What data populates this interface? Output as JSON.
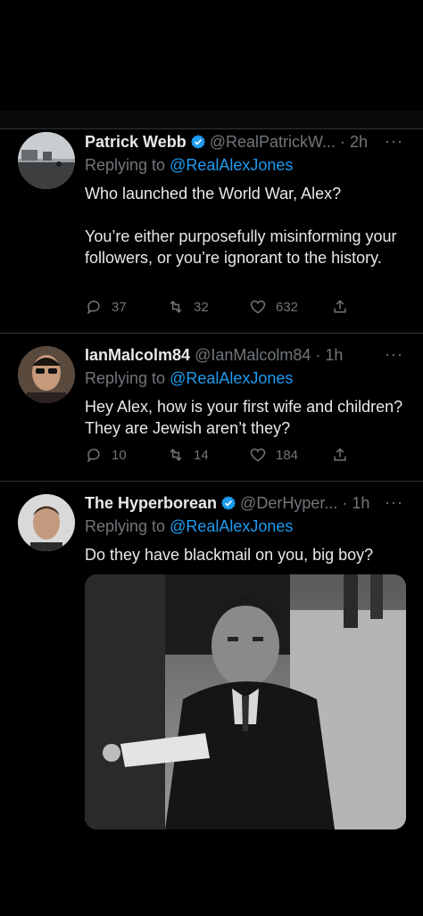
{
  "colors": {
    "background": "#000000",
    "text": "#e7e9ea",
    "muted": "#71767b",
    "link": "#1d9bf0",
    "verified": "#1d9bf0"
  },
  "replying_prefix": "Replying to",
  "tweets": [
    {
      "name": "Patrick Webb",
      "verified": true,
      "handle": "@RealPatrickW...",
      "time": "· 2h",
      "reply_to": "@RealAlexJones",
      "text": "Who launched the World War, Alex?\n\nYou’re either purposefully misinforming your followers, or you’re ignorant to the history.",
      "replies": "37",
      "retweets": "32",
      "likes": "632",
      "avatar_icon": "avatar-photo-icon"
    },
    {
      "name": "IanMalcolm84",
      "verified": false,
      "handle": "@IanMalcolm84",
      "time": "· 1h",
      "reply_to": "@RealAlexJones",
      "text": "Hey Alex, how is your first wife and children? They are Jewish aren’t they?",
      "replies": "10",
      "retweets": "14",
      "likes": "184",
      "avatar_icon": "avatar-photo-icon"
    },
    {
      "name": "The Hyperborean",
      "verified": true,
      "handle": "@DerHyper...",
      "time": "· 1h",
      "reply_to": "@RealAlexJones",
      "text": "Do they have blackmail on you, big boy?",
      "avatar_icon": "avatar-photo-icon",
      "media_icon": "black-and-white-photo-icon"
    }
  ],
  "more_glyph": "···"
}
